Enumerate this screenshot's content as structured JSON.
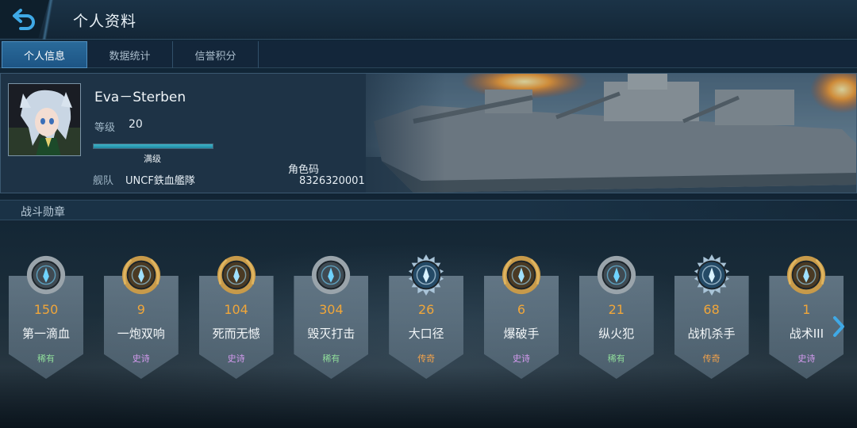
{
  "header": {
    "title": "个人资料",
    "back_icon": "back-arrow-icon"
  },
  "tabs": [
    {
      "label": "个人信息",
      "active": true
    },
    {
      "label": "数据统计",
      "active": false
    },
    {
      "label": "信誉积分",
      "active": false
    }
  ],
  "profile": {
    "name": "Eva－Sterben",
    "level_label": "等级",
    "level_value": "20",
    "level_progress": 1.0,
    "level_status": "满级",
    "fleet_label": "舰队",
    "fleet_value": "UNCF鉄血艦隊",
    "role_code_label": "角色码",
    "role_code_value": "8326320001"
  },
  "medals_section": {
    "title": "战斗勋章"
  },
  "medals": [
    {
      "count": "150",
      "name": "第一滴血",
      "rarity": "稀有",
      "rarity_color": "#8fdc9a",
      "frame": "silver",
      "icon": "blood-drop-medal-icon"
    },
    {
      "count": "9",
      "name": "一炮双响",
      "rarity": "史诗",
      "rarity_color": "#d59bf0",
      "frame": "gold",
      "icon": "double-shot-medal-icon"
    },
    {
      "count": "104",
      "name": "死而无憾",
      "rarity": "史诗",
      "rarity_color": "#d59bf0",
      "frame": "gold",
      "icon": "no-regret-medal-icon"
    },
    {
      "count": "304",
      "name": "毁灭打击",
      "rarity": "稀有",
      "rarity_color": "#8fdc9a",
      "frame": "silver",
      "icon": "devastating-strike-medal-icon"
    },
    {
      "count": "26",
      "name": "大口径",
      "rarity": "传奇",
      "rarity_color": "#f3a24a",
      "frame": "blue",
      "icon": "big-caliber-medal-icon"
    },
    {
      "count": "6",
      "name": "爆破手",
      "rarity": "史诗",
      "rarity_color": "#d59bf0",
      "frame": "gold",
      "icon": "demolition-medal-icon"
    },
    {
      "count": "21",
      "name": "纵火犯",
      "rarity": "稀有",
      "rarity_color": "#8fdc9a",
      "frame": "silver",
      "icon": "arsonist-medal-icon"
    },
    {
      "count": "68",
      "name": "战机杀手",
      "rarity": "传奇",
      "rarity_color": "#f3a24a",
      "frame": "blue",
      "icon": "aircraft-killer-medal-icon"
    },
    {
      "count": "1",
      "name": "战术III",
      "rarity": "史诗",
      "rarity_color": "#d59bf0",
      "frame": "gold",
      "icon": "tactics-medal-icon"
    }
  ],
  "colors": {
    "accent": "#2a6a9a",
    "count": "#f0a63a",
    "progress": "#3fb4c8"
  }
}
